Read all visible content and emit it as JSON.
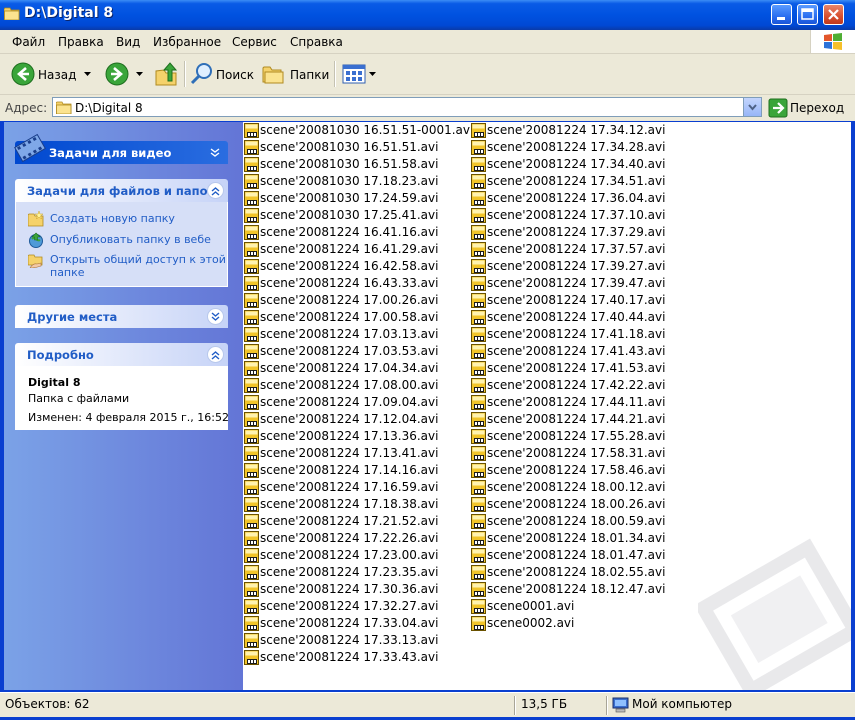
{
  "window": {
    "title": "D:\\Digital 8"
  },
  "menu": [
    "Файл",
    "Правка",
    "Вид",
    "Избранное",
    "Сервис",
    "Справка"
  ],
  "toolbar": {
    "back": "Назад",
    "search": "Поиск",
    "folders": "Папки"
  },
  "address": {
    "label": "Адрес:",
    "value": "D:\\Digital 8",
    "go": "Переход"
  },
  "sidebar": {
    "video_tasks": {
      "title": "Задачи для видео"
    },
    "file_tasks": {
      "title": "Задачи для файлов и папок",
      "items": [
        "Создать новую папку",
        "Опубликовать папку в вебе",
        "Открыть общий доступ к этой",
        "папке"
      ]
    },
    "other_places": {
      "title": "Другие места"
    },
    "details": {
      "title": "Подробно",
      "name": "Digital 8",
      "type": "Папка с файлами",
      "modified": "Изменен: 4 февраля 2015 г., 16:52"
    }
  },
  "files": {
    "col1": [
      "scene'20081030 16.51.51-0001.avi",
      "scene'20081030 16.51.51.avi",
      "scene'20081030 16.51.58.avi",
      "scene'20081030 17.18.23.avi",
      "scene'20081030 17.24.59.avi",
      "scene'20081030 17.25.41.avi",
      "scene'20081224 16.41.16.avi",
      "scene'20081224 16.41.29.avi",
      "scene'20081224 16.42.58.avi",
      "scene'20081224 16.43.33.avi",
      "scene'20081224 17.00.26.avi",
      "scene'20081224 17.00.58.avi",
      "scene'20081224 17.03.13.avi",
      "scene'20081224 17.03.53.avi",
      "scene'20081224 17.04.34.avi",
      "scene'20081224 17.08.00.avi",
      "scene'20081224 17.09.04.avi",
      "scene'20081224 17.12.04.avi",
      "scene'20081224 17.13.36.avi",
      "scene'20081224 17.13.41.avi",
      "scene'20081224 17.14.16.avi",
      "scene'20081224 17.16.59.avi",
      "scene'20081224 17.18.38.avi",
      "scene'20081224 17.21.52.avi",
      "scene'20081224 17.22.26.avi",
      "scene'20081224 17.23.00.avi",
      "scene'20081224 17.23.35.avi",
      "scene'20081224 17.30.36.avi",
      "scene'20081224 17.32.27.avi",
      "scene'20081224 17.33.04.avi",
      "scene'20081224 17.33.13.avi",
      "scene'20081224 17.33.43.avi"
    ],
    "col2": [
      "scene'20081224 17.34.12.avi",
      "scene'20081224 17.34.28.avi",
      "scene'20081224 17.34.40.avi",
      "scene'20081224 17.34.51.avi",
      "scene'20081224 17.36.04.avi",
      "scene'20081224 17.37.10.avi",
      "scene'20081224 17.37.29.avi",
      "scene'20081224 17.37.57.avi",
      "scene'20081224 17.39.27.avi",
      "scene'20081224 17.39.47.avi",
      "scene'20081224 17.40.17.avi",
      "scene'20081224 17.40.44.avi",
      "scene'20081224 17.41.18.avi",
      "scene'20081224 17.41.43.avi",
      "scene'20081224 17.41.53.avi",
      "scene'20081224 17.42.22.avi",
      "scene'20081224 17.44.11.avi",
      "scene'20081224 17.44.21.avi",
      "scene'20081224 17.55.28.avi",
      "scene'20081224 17.58.31.avi",
      "scene'20081224 17.58.46.avi",
      "scene'20081224 18.00.12.avi",
      "scene'20081224 18.00.26.avi",
      "scene'20081224 18.00.59.avi",
      "scene'20081224 18.01.34.avi",
      "scene'20081224 18.01.47.avi",
      "scene'20081224 18.02.55.avi",
      "scene'20081224 18.12.47.avi",
      "scene0001.avi",
      "scene0002.avi"
    ]
  },
  "status": {
    "objects": "Объектов: 62",
    "size": "13,5 ГБ",
    "location": "Мой компьютер"
  },
  "colors": {
    "title_blue": "#0052e0",
    "sidebar_blue": "#6375d6",
    "link_blue": "#215dc6",
    "chrome": "#ece9d8"
  }
}
